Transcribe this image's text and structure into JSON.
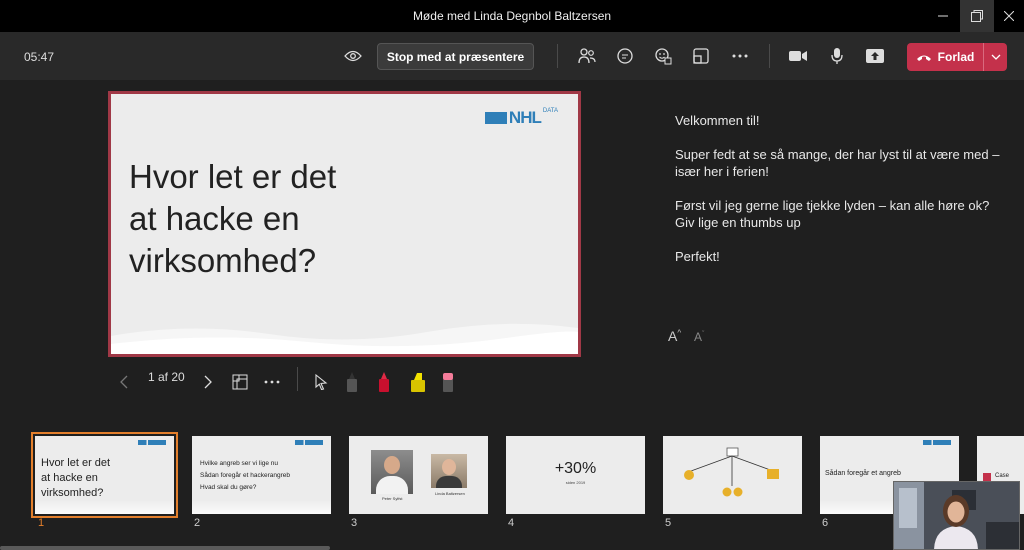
{
  "window": {
    "title": "Møde med Linda Degnbol Baltzersen"
  },
  "toolbar": {
    "time": "05:47",
    "stop_label": "Stop med at præsentere",
    "leave_label": "Forlad"
  },
  "slide": {
    "logo_text": "NHL",
    "logo_sup": "DATA",
    "title_lines": [
      "Hvor let er det",
      "at hacke en",
      "virksomhed?"
    ],
    "page_indicator": "1 af 20"
  },
  "notes": {
    "paragraphs": [
      "Velkommen til!",
      "Super fedt at se så mange, der har lyst til at være med – især her i ferien!",
      "Først vil jeg gerne lige tjekke lyden – kan alle høre ok? Giv lige en thumbs up",
      "Perfekt!"
    ],
    "increase_font": "A",
    "decrease_font": "A"
  },
  "thumbnails": [
    {
      "number": "1",
      "lines": [
        "Hvor let er det",
        "at hacke en",
        "virksomhed?"
      ]
    },
    {
      "number": "2",
      "lines": [
        "Hvilke angreb ser vi lige nu",
        "Sådan foregår et hackerangreb",
        "Hvad skal du gøre?"
      ]
    },
    {
      "number": "3",
      "captions": [
        "Peter Sylfst",
        "Linda Baltzersen"
      ]
    },
    {
      "number": "4",
      "big": "+30%",
      "small": "siden 2019"
    },
    {
      "number": "5"
    },
    {
      "number": "6",
      "lines": [
        "Sådan foregår et angreb"
      ]
    },
    {
      "number": "",
      "lines": [
        "Case"
      ]
    }
  ],
  "colors": {
    "accent": "#c4314b",
    "selection": "#e37f2c",
    "brand": "#2f7fb8"
  },
  "icons": [
    "eye-icon",
    "people-icon",
    "chat-icon",
    "reactions-icon",
    "rooms-icon",
    "more-icon",
    "camera-icon",
    "mic-icon",
    "share-icon",
    "phone-icon"
  ]
}
